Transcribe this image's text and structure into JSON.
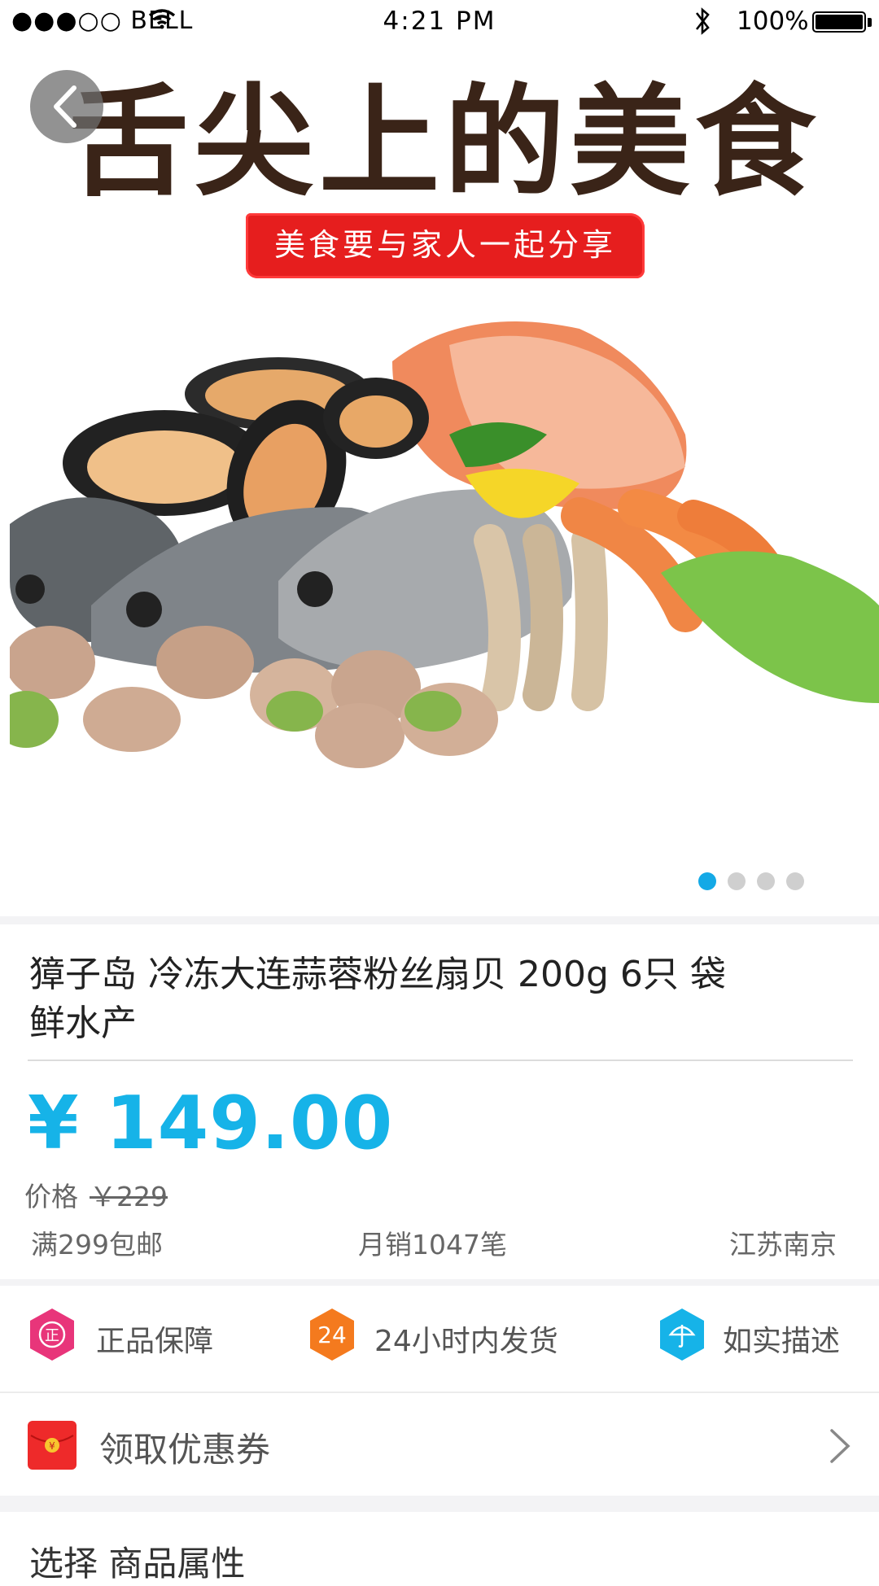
{
  "status_bar": {
    "carrier": "●●●○○ BELL",
    "time": "4:21 PM",
    "battery": "100%"
  },
  "banner": {
    "headline": "舌尖上的美食",
    "ribbon": "美食要与家人一起分享",
    "carousel_pages": 4,
    "carousel_active_index": 0
  },
  "product": {
    "title_line1": "獐子岛 冷冻大连蒜蓉粉丝扇贝 200g 6只 袋",
    "title_line2": "鲜水产",
    "price": "¥ 149.00",
    "original_label": "价格",
    "original_price": "￥229",
    "shipping": "满299包邮",
    "monthly_sales": "月销1047笔",
    "location": "江苏南京"
  },
  "guarantees": [
    {
      "icon": "shield-icon",
      "label": "正品保障",
      "color": "#e8357a",
      "glyph": "正"
    },
    {
      "icon": "24h-icon",
      "label": "24小时内发货",
      "color": "#f47a1e",
      "glyph": "24"
    },
    {
      "icon": "umbrella-icon",
      "label": "如实描述",
      "color": "#16b3e8",
      "glyph": ""
    }
  ],
  "coupon": {
    "label": "领取优惠券",
    "icon": "red-envelope-icon"
  },
  "next_section": {
    "label": "选择  商品属性"
  },
  "colors": {
    "accent": "#16b3e8",
    "ribbon": "#e61e1e"
  }
}
